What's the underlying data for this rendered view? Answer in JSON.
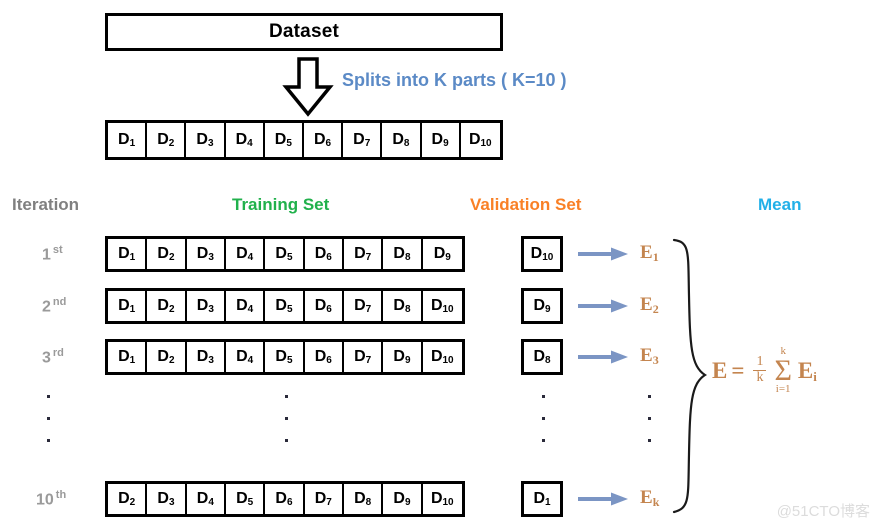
{
  "diagram": {
    "title_box": "Dataset",
    "split_note": "Splits into K parts ( K=10 )",
    "watermark": "@51CTO博客"
  },
  "colors": {
    "split_note": "#5b8ac6",
    "training_header": "#21b14c",
    "validation_header": "#f98026",
    "mean_header": "#22b0e8",
    "iteration_header": "#808080",
    "error_label": "#c4854f",
    "arrow": "#7b95c4",
    "box_border": "#000000"
  },
  "headers": {
    "iteration": "Iteration",
    "training": "Training Set",
    "validation": "Validation Set",
    "mean": "Mean"
  },
  "split_row": {
    "parts": [
      {
        "base": "D",
        "sub": "1"
      },
      {
        "base": "D",
        "sub": "2"
      },
      {
        "base": "D",
        "sub": "3"
      },
      {
        "base": "D",
        "sub": "4"
      },
      {
        "base": "D",
        "sub": "5"
      },
      {
        "base": "D",
        "sub": "6"
      },
      {
        "base": "D",
        "sub": "7"
      },
      {
        "base": "D",
        "sub": "8"
      },
      {
        "base": "D",
        "sub": "9"
      },
      {
        "base": "D",
        "sub": "10"
      }
    ]
  },
  "iterations": [
    {
      "ordinal_number": "1",
      "ordinal_suffix": "st",
      "training": [
        {
          "base": "D",
          "sub": "1"
        },
        {
          "base": "D",
          "sub": "2"
        },
        {
          "base": "D",
          "sub": "3"
        },
        {
          "base": "D",
          "sub": "4"
        },
        {
          "base": "D",
          "sub": "5"
        },
        {
          "base": "D",
          "sub": "6"
        },
        {
          "base": "D",
          "sub": "7"
        },
        {
          "base": "D",
          "sub": "8"
        },
        {
          "base": "D",
          "sub": "9"
        }
      ],
      "validation": {
        "base": "D",
        "sub": "10"
      },
      "error": {
        "base": "E",
        "sub": "1"
      }
    },
    {
      "ordinal_number": "2",
      "ordinal_suffix": "nd",
      "training": [
        {
          "base": "D",
          "sub": "1"
        },
        {
          "base": "D",
          "sub": "2"
        },
        {
          "base": "D",
          "sub": "3"
        },
        {
          "base": "D",
          "sub": "4"
        },
        {
          "base": "D",
          "sub": "5"
        },
        {
          "base": "D",
          "sub": "6"
        },
        {
          "base": "D",
          "sub": "7"
        },
        {
          "base": "D",
          "sub": "8"
        },
        {
          "base": "D",
          "sub": "10"
        }
      ],
      "validation": {
        "base": "D",
        "sub": "9"
      },
      "error": {
        "base": "E",
        "sub": "2"
      }
    },
    {
      "ordinal_number": "3",
      "ordinal_suffix": "rd",
      "training": [
        {
          "base": "D",
          "sub": "1"
        },
        {
          "base": "D",
          "sub": "2"
        },
        {
          "base": "D",
          "sub": "3"
        },
        {
          "base": "D",
          "sub": "4"
        },
        {
          "base": "D",
          "sub": "5"
        },
        {
          "base": "D",
          "sub": "6"
        },
        {
          "base": "D",
          "sub": "7"
        },
        {
          "base": "D",
          "sub": "9"
        },
        {
          "base": "D",
          "sub": "10"
        }
      ],
      "validation": {
        "base": "D",
        "sub": "8"
      },
      "error": {
        "base": "E",
        "sub": "3"
      }
    },
    {
      "ordinal_number": "10",
      "ordinal_suffix": "th",
      "training": [
        {
          "base": "D",
          "sub": "2"
        },
        {
          "base": "D",
          "sub": "3"
        },
        {
          "base": "D",
          "sub": "4"
        },
        {
          "base": "D",
          "sub": "5"
        },
        {
          "base": "D",
          "sub": "6"
        },
        {
          "base": "D",
          "sub": "7"
        },
        {
          "base": "D",
          "sub": "8"
        },
        {
          "base": "D",
          "sub": "9"
        },
        {
          "base": "D",
          "sub": "10"
        }
      ],
      "validation": {
        "base": "D",
        "sub": "1"
      },
      "error": {
        "base": "E",
        "sub": "k"
      }
    }
  ],
  "ellipsis": {
    "columns": [
      "iteration",
      "training",
      "validation",
      "error"
    ],
    "dots_per_column": 3
  },
  "formula": {
    "lhs": "E",
    "equals": "=",
    "fraction_numerator": "1",
    "fraction_denominator": "k",
    "sigma": "Σ",
    "sigma_upper": "k",
    "sigma_lower": "i=1",
    "term": "E",
    "term_sub": "i"
  }
}
